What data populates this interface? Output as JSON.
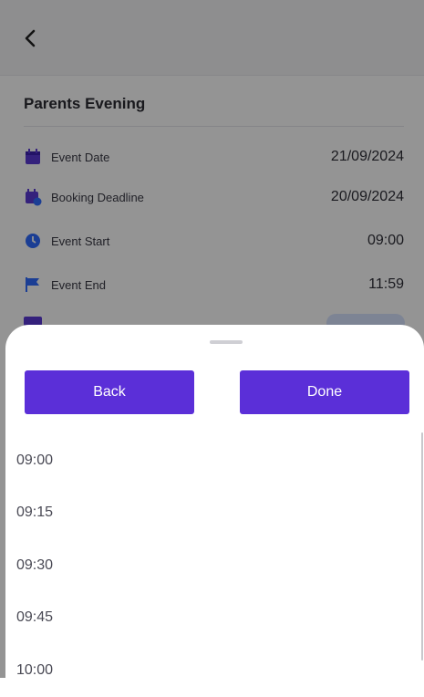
{
  "background": {
    "event_title": "Parents Evening",
    "details": [
      {
        "label": "Event Date",
        "value": "21/09/2024",
        "icon": "calendar-icon"
      },
      {
        "label": "Booking Deadline",
        "value": "20/09/2024",
        "icon": "calendar-clock-icon"
      },
      {
        "label": "Event Start",
        "value": "09:00",
        "icon": "clock-icon"
      },
      {
        "label": "Event End",
        "value": "11:59",
        "icon": "flag-icon"
      }
    ]
  },
  "sheet": {
    "back_label": "Back",
    "done_label": "Done",
    "times": [
      "09:00",
      "09:15",
      "09:30",
      "09:45",
      "10:00"
    ]
  },
  "colors": {
    "accent": "#5b2fd8",
    "icon_purple": "#5b3ad6",
    "icon_blue": "#2f6bff"
  }
}
